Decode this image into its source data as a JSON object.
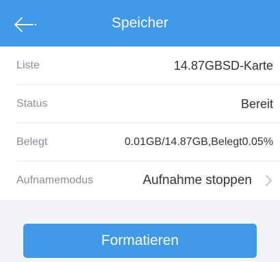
{
  "header": {
    "title": "Speicher",
    "back_icon": "arrow-left-icon",
    "color": "#3f99e8"
  },
  "rows": [
    {
      "label": "Liste",
      "value": "14.87GBSD-Karte"
    },
    {
      "label": "Status",
      "value": "Bereit"
    },
    {
      "label": "Belegt",
      "value": "0.01GB/14.87GB,Belegt0.05%"
    },
    {
      "label": "Aufnamemodus",
      "value": "Aufnahme stoppen",
      "icon": "chevron-right-icon"
    }
  ],
  "actions": {
    "format_label": "Formatieren"
  }
}
